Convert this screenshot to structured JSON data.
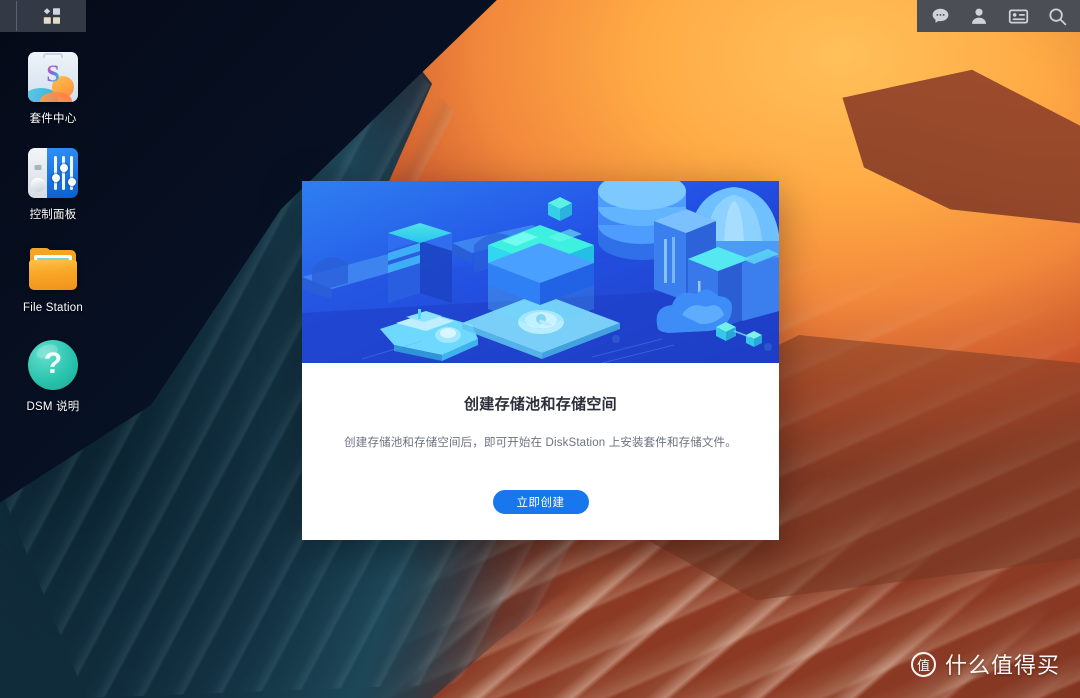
{
  "taskbar": {
    "apps_menu": {
      "name": "apps-grid",
      "label": ""
    },
    "right_icons": [
      {
        "name": "chat-icon",
        "label": ""
      },
      {
        "name": "user-icon",
        "label": ""
      },
      {
        "name": "notifications-icon",
        "label": ""
      },
      {
        "name": "search-icon",
        "label": ""
      }
    ]
  },
  "desktop": {
    "icons": [
      {
        "id": "package-center",
        "label": "套件中心",
        "icon": "package-center-icon"
      },
      {
        "id": "control-panel",
        "label": "控制面板",
        "icon": "control-panel-icon"
      },
      {
        "id": "file-station",
        "label": "File Station",
        "icon": "folder-icon"
      },
      {
        "id": "dsm-help",
        "label": "DSM 说明",
        "icon": "question-mark-icon"
      }
    ]
  },
  "dialog": {
    "title": "创建存储池和存储空间",
    "description": "创建存储池和存储空间后，即可开始在 DiskStation 上安装套件和存储文件。",
    "primary_button": "立即创建",
    "hero_illustration": "isometric-storage-city-illustration",
    "accent_color": "#1877ec"
  },
  "watermark": {
    "logo_char": "值",
    "text": "什么值得买"
  }
}
